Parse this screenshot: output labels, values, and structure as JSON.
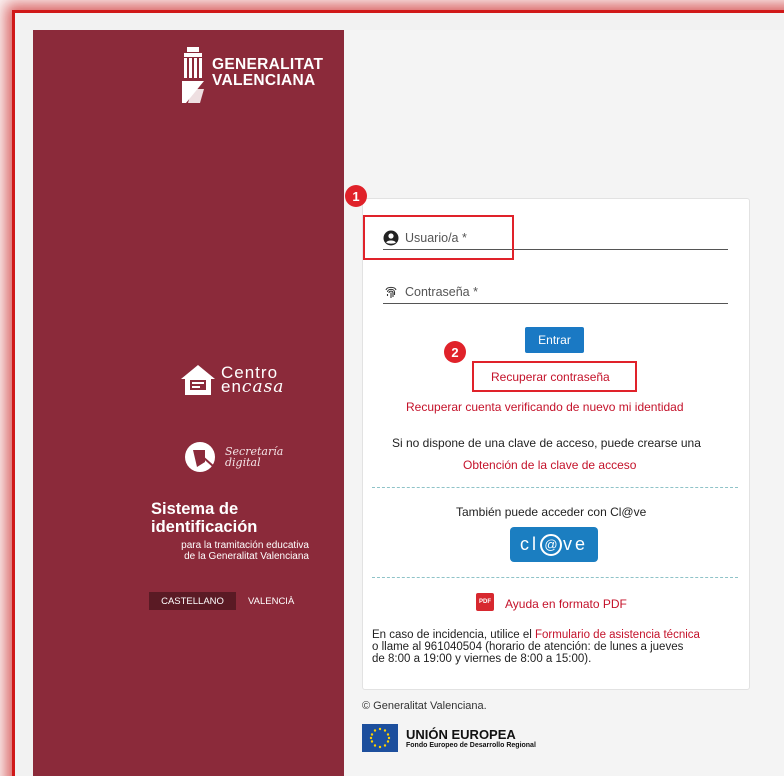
{
  "sidebar": {
    "brand_line1": "GENERALITAT",
    "brand_line2": "VALENCIANA",
    "centro_line1": "Centro",
    "centro_line2_en": "en",
    "centro_line2_casa": "casa",
    "secretaria_line1": "Secretaría",
    "secretaria_line2": "digital",
    "system_title_line1": "Sistema de",
    "system_title_line2": "identificación",
    "system_sub_line1": "para la tramitación educativa",
    "system_sub_line2": "de la Generalitat Valenciana",
    "languages": [
      "CASTELLANO",
      "VALENCIÀ"
    ],
    "active_language": "CASTELLANO",
    "color": "#8b2a3a"
  },
  "form": {
    "user_label": "Usuario/a *",
    "password_label": "Contraseña *",
    "enter_button": "Entrar",
    "recover_password": "Recuperar contraseña",
    "recover_account": "Recuperar cuenta verificando de nuevo mi identidad",
    "no_key_text": "Si no dispone de una clave de acceso, puede crearse una",
    "obtain_key": "Obtención de la clave de acceso",
    "clave_text": "También puede acceder con Cl@ve",
    "clave_button_left": "cl",
    "clave_button_at": "@",
    "clave_button_right": "ve",
    "pdf_help": "Ayuda en formato PDF",
    "pdf_icon_text": "PDF",
    "incident_prefix": "En caso de incidencia, utilice el ",
    "incident_link": "Formulario de asistencia técnica",
    "incident_line2": "o llame al 961040504 (horario de atención: de lunes a jueves",
    "incident_line3": "de 8:00 a 19:00 y viernes de 8:00 a 15:00)."
  },
  "annotations": {
    "badge1": "1",
    "badge2": "2",
    "color": "#e0222a"
  },
  "footer": {
    "copyright": "© Generalitat Valenciana.",
    "eu_title": "UNIÓN EUROPEA",
    "eu_subtitle": "Fondo Europeo de Desarrollo Regional"
  }
}
